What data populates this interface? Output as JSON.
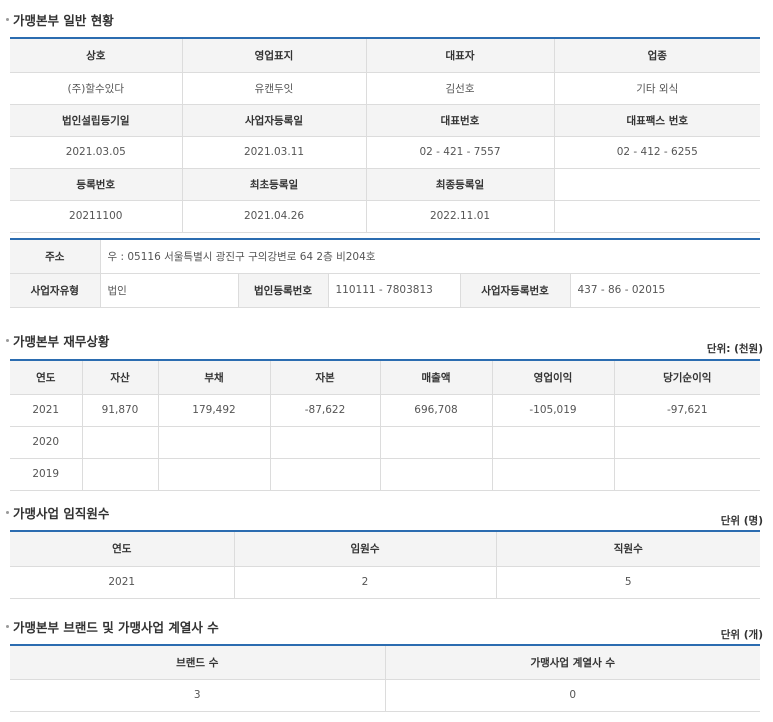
{
  "sec1": {
    "title": "가맹본부 일반 현황",
    "h1": [
      "상호",
      "영업표지",
      "대표자",
      "업종"
    ],
    "r1": [
      "(주)할수있다",
      "유캔두잇",
      "김선호",
      "기타 외식"
    ],
    "h2": [
      "법인설립등기일",
      "사업자등록일",
      "대표번호",
      "대표팩스 번호"
    ],
    "r2": [
      "2021.03.05",
      "2021.03.11",
      "02 - 421 - 7557",
      "02 - 412 - 6255"
    ],
    "h3": [
      "등록번호",
      "최초등록일",
      "최종등록일",
      ""
    ],
    "r3": [
      "20211100",
      "2021.04.26",
      "2022.11.01",
      ""
    ]
  },
  "addr": {
    "address_label": "주소",
    "address_value": "우 : 05116 서울특별시 광진구 구의강변로 64 2층 비204호",
    "biz_type_label": "사업자유형",
    "biz_type_value": "법인",
    "corp_reg_label": "법인등록번호",
    "corp_reg_value": "110111 - 7803813",
    "biz_reg_label": "사업자등록번호",
    "biz_reg_value": "437 - 86 - 02015"
  },
  "sec2": {
    "title": "가맹본부 재무상황",
    "unit": "단위: (천원)",
    "headers": [
      "연도",
      "자산",
      "부채",
      "자본",
      "매출액",
      "영업이익",
      "당기순이익"
    ],
    "rows": [
      [
        "2021",
        "91,870",
        "179,492",
        "-87,622",
        "696,708",
        "-105,019",
        "-97,621"
      ],
      [
        "2020",
        "",
        "",
        "",
        "",
        "",
        ""
      ],
      [
        "2019",
        "",
        "",
        "",
        "",
        "",
        ""
      ]
    ]
  },
  "sec3": {
    "title": "가맹사업 임직원수",
    "unit": "단위 (명)",
    "headers": [
      "연도",
      "임원수",
      "직원수"
    ],
    "row": [
      "2021",
      "2",
      "5"
    ]
  },
  "sec4": {
    "title": "가맹본부 브랜드 및 가맹사업 계열사 수",
    "unit": "단위 (개)",
    "headers": [
      "브랜드 수",
      "가맹사업 계열사 수"
    ],
    "row": [
      "3",
      "0"
    ]
  }
}
